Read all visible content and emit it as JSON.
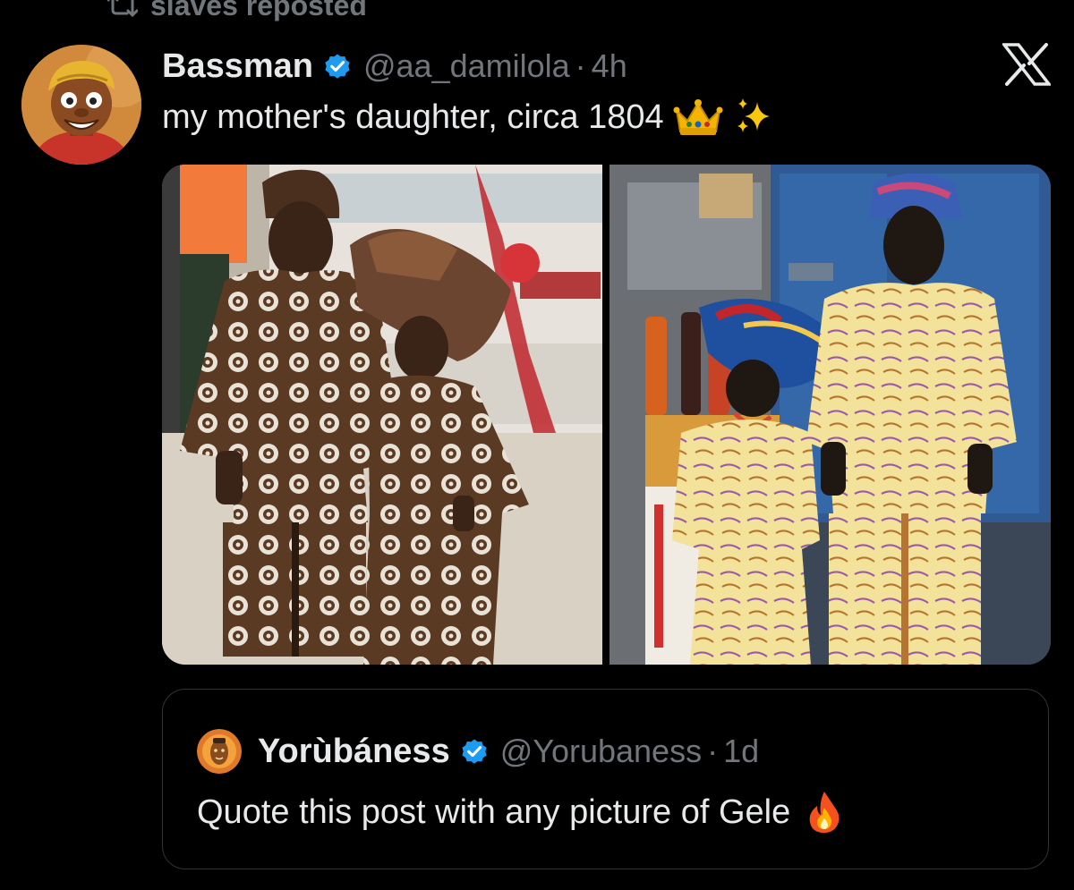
{
  "repost": {
    "text": "slaves reposted",
    "icon": "repost-icon"
  },
  "tweet": {
    "author": {
      "display_name": "Bassman",
      "handle": "@aa_damilola",
      "verified": true,
      "avatar_icon": "cartoon-avatar"
    },
    "separator": "·",
    "time": "4h",
    "text": "my mother's daughter, circa 1804",
    "emojis": [
      "crown-emoji",
      "sparkles-emoji"
    ],
    "media": [
      {
        "name": "photo-children-brown-agbada"
      },
      {
        "name": "photo-children-yellow-agbada"
      }
    ]
  },
  "quoted_tweet": {
    "author": {
      "display_name": "Yorùbáness",
      "handle": "@Yorubaness",
      "verified": true,
      "avatar_icon": "orange-mask-avatar"
    },
    "separator": "·",
    "time": "1d",
    "text": "Quote this post with any picture of Gele",
    "emoji": "fire-emoji"
  },
  "platform": {
    "logo_icon": "x-logo-icon"
  },
  "colors": {
    "background": "#000000",
    "text_primary": "#e7e9ea",
    "text_secondary": "#71767b",
    "verified_blue": "#1d9bf0",
    "border": "#2f3336"
  }
}
